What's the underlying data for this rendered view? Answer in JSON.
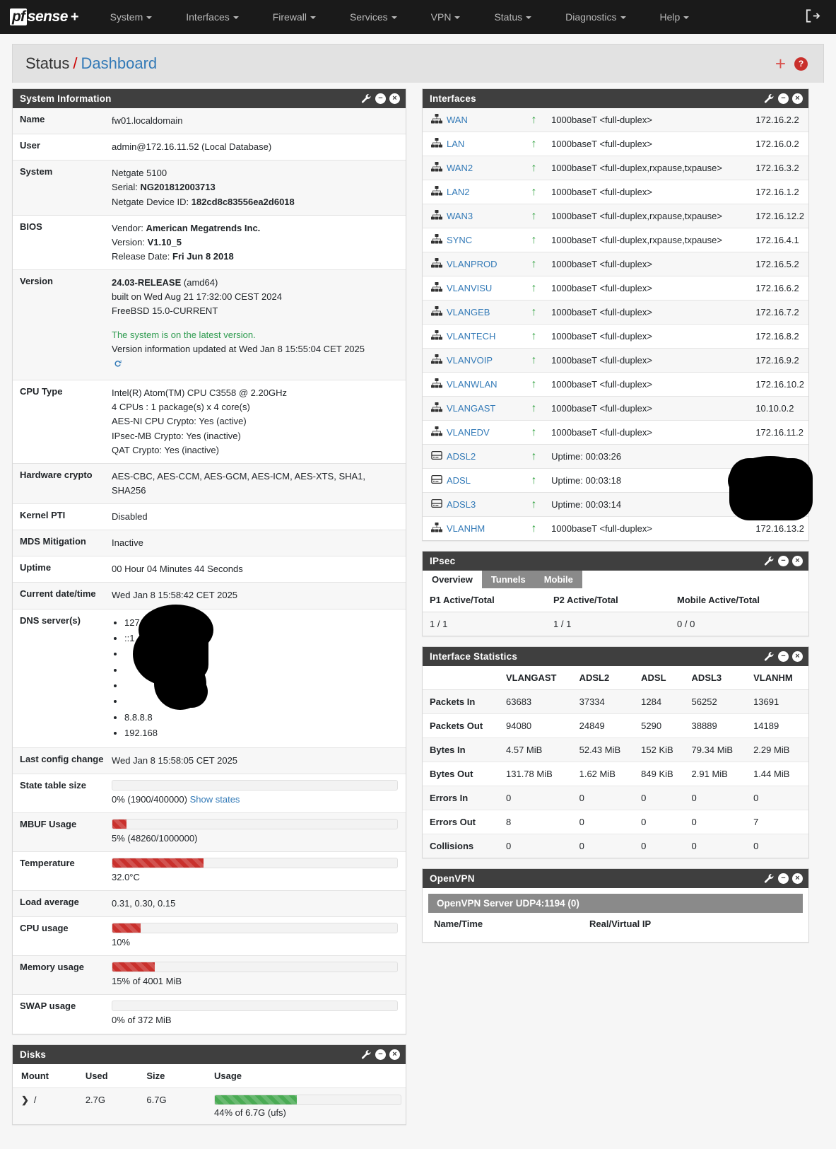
{
  "navbar": {
    "brand": {
      "pf": "pf",
      "sense": "sense",
      "plus": "+"
    },
    "items": [
      {
        "label": "System"
      },
      {
        "label": "Interfaces"
      },
      {
        "label": "Firewall"
      },
      {
        "label": "Services"
      },
      {
        "label": "VPN"
      },
      {
        "label": "Status"
      },
      {
        "label": "Diagnostics"
      },
      {
        "label": "Help"
      }
    ],
    "logout_icon": "logout-icon"
  },
  "breadcrumb": {
    "section": "Status",
    "separator": "/",
    "page": "Dashboard",
    "add_widget_icon": "+",
    "help_icon": "?"
  },
  "system_information": {
    "title": "System Information",
    "rows": [
      {
        "label": "Name",
        "value": "fw01.localdomain"
      },
      {
        "label": "User",
        "value": "admin@172.16.11.52 (Local Database)"
      },
      {
        "label": "System",
        "value": "Netgate 5100"
      },
      {
        "label": "BIOS",
        "value": ""
      },
      {
        "label": "Version",
        "value": ""
      }
    ],
    "system_model": "Netgate 5100",
    "system_serial_label": "Serial:",
    "system_serial": "NG201812003713",
    "system_devid_label": "Netgate Device ID:",
    "system_devid": "182cd8c83556ea2d6018",
    "bios_vendor_label": "Vendor:",
    "bios_vendor": "American Megatrends Inc.",
    "bios_version_label": "Version:",
    "bios_version": "V1.10_5",
    "bios_release_label": "Release Date:",
    "bios_release": "Fri Jun 8 2018",
    "version_release": "24.03-RELEASE",
    "version_arch": "(amd64)",
    "version_built": "built on Wed Aug 21 17:32:00 CEST 2024",
    "version_freebsd": "FreeBSD 15.0-CURRENT",
    "version_status": "The system is on the latest version.",
    "version_updated": "Version information updated at Wed Jan 8 15:55:04 CET 2025",
    "refresh_icon": "refresh-icon",
    "cpu_type_label": "CPU Type",
    "cpu_type_lines": [
      "Intel(R) Atom(TM) CPU C3558 @ 2.20GHz",
      "4 CPUs : 1 package(s) x 4 core(s)",
      "AES-NI CPU Crypto: Yes (active)",
      "IPsec-MB Crypto: Yes (inactive)",
      "QAT Crypto: Yes (inactive)"
    ],
    "hardware_crypto_label": "Hardware crypto",
    "hardware_crypto": "AES-CBC, AES-CCM, AES-GCM, AES-ICM, AES-XTS, SHA1, SHA256",
    "kernel_pti_label": "Kernel PTI",
    "kernel_pti": "Disabled",
    "mds_label": "MDS Mitigation",
    "mds": "Inactive",
    "uptime_label": "Uptime",
    "uptime": "00 Hour 04 Minutes 44 Seconds",
    "datetime_label": "Current date/time",
    "datetime": "Wed Jan 8 15:58:42 CET 2025",
    "dns_label": "DNS server(s)",
    "dns_servers": [
      "127.0.0.1",
      "::1",
      "",
      "",
      "",
      "",
      "8.8.8.8",
      "192.168"
    ],
    "last_config_label": "Last config change",
    "last_config": "Wed Jan 8 15:58:05 CET 2025",
    "state_table_label": "State table size",
    "state_table_pct": 0,
    "state_table_text": "0% (1900/400000)",
    "state_table_link": "Show states",
    "mbuf_label": "MBUF Usage",
    "mbuf_pct": 5,
    "mbuf_text": "5% (48260/1000000)",
    "temp_label": "Temperature",
    "temp_pct": 32,
    "temp_text": "32.0°C",
    "load_label": "Load average",
    "load": "0.31, 0.30, 0.15",
    "cpu_usage_label": "CPU usage",
    "cpu_usage_pct": 10,
    "cpu_usage_text": "10%",
    "memory_label": "Memory usage",
    "memory_pct": 15,
    "memory_text": "15% of 4001 MiB",
    "swap_label": "SWAP usage",
    "swap_pct": 0,
    "swap_text": "0% of 372 MiB"
  },
  "disks": {
    "title": "Disks",
    "headers": [
      "Mount",
      "Used",
      "Size",
      "Usage"
    ],
    "rows": [
      {
        "mount": "/",
        "used": "2.7G",
        "size": "6.7G",
        "usage_pct": 44,
        "usage_text": "44% of 6.7G (ufs)"
      }
    ]
  },
  "interfaces": {
    "title": "Interfaces",
    "rows": [
      {
        "name": "WAN",
        "icon": "sitemap-icon",
        "status": "up",
        "media": "1000baseT <full-duplex>",
        "ip": "172.16.2.2"
      },
      {
        "name": "LAN",
        "icon": "sitemap-icon",
        "status": "up",
        "media": "1000baseT <full-duplex>",
        "ip": "172.16.0.2"
      },
      {
        "name": "WAN2",
        "icon": "sitemap-icon",
        "status": "up",
        "media": "1000baseT <full-duplex,rxpause,txpause>",
        "ip": "172.16.3.2"
      },
      {
        "name": "LAN2",
        "icon": "sitemap-icon",
        "status": "up",
        "media": "1000baseT <full-duplex>",
        "ip": "172.16.1.2"
      },
      {
        "name": "WAN3",
        "icon": "sitemap-icon",
        "status": "up",
        "media": "1000baseT <full-duplex,rxpause,txpause>",
        "ip": "172.16.12.2"
      },
      {
        "name": "SYNC",
        "icon": "sitemap-icon",
        "status": "up",
        "media": "1000baseT <full-duplex,rxpause,txpause>",
        "ip": "172.16.4.1"
      },
      {
        "name": "VLANPROD",
        "icon": "sitemap-icon",
        "status": "up",
        "media": "1000baseT <full-duplex>",
        "ip": "172.16.5.2"
      },
      {
        "name": "VLANVISU",
        "icon": "sitemap-icon",
        "status": "up",
        "media": "1000baseT <full-duplex>",
        "ip": "172.16.6.2"
      },
      {
        "name": "VLANGEB",
        "icon": "sitemap-icon",
        "status": "up",
        "media": "1000baseT <full-duplex>",
        "ip": "172.16.7.2"
      },
      {
        "name": "VLANTECH",
        "icon": "sitemap-icon",
        "status": "up",
        "media": "1000baseT <full-duplex>",
        "ip": "172.16.8.2"
      },
      {
        "name": "VLANVOIP",
        "icon": "sitemap-icon",
        "status": "up",
        "media": "1000baseT <full-duplex>",
        "ip": "172.16.9.2"
      },
      {
        "name": "VLANWLAN",
        "icon": "sitemap-icon",
        "status": "up",
        "media": "1000baseT <full-duplex>",
        "ip": "172.16.10.2"
      },
      {
        "name": "VLANGAST",
        "icon": "sitemap-icon",
        "status": "up",
        "media": "1000baseT <full-duplex>",
        "ip": "10.10.0.2"
      },
      {
        "name": "VLANEDV",
        "icon": "sitemap-icon",
        "status": "up",
        "media": "1000baseT <full-duplex>",
        "ip": "172.16.11.2"
      },
      {
        "name": "ADSL2",
        "icon": "modem-icon",
        "status": "up",
        "media": "Uptime: 00:03:26",
        "ip": ""
      },
      {
        "name": "ADSL",
        "icon": "modem-icon",
        "status": "up",
        "media": "Uptime: 00:03:18",
        "ip": ""
      },
      {
        "name": "ADSL3",
        "icon": "modem-icon",
        "status": "up",
        "media": "Uptime: 00:03:14",
        "ip": ""
      },
      {
        "name": "VLANHM",
        "icon": "sitemap-icon",
        "status": "up",
        "media": "1000baseT <full-duplex>",
        "ip": "172.16.13.2"
      }
    ]
  },
  "ipsec": {
    "title": "IPsec",
    "tabs": [
      {
        "label": "Overview",
        "active": true
      },
      {
        "label": "Tunnels",
        "active": false
      },
      {
        "label": "Mobile",
        "active": false
      }
    ],
    "headers": [
      "P1 Active/Total",
      "P2 Active/Total",
      "Mobile Active/Total"
    ],
    "values": [
      "1 / 1",
      "1 / 1",
      "0 / 0"
    ]
  },
  "interface_statistics": {
    "title": "Interface Statistics",
    "columns": [
      "VLANGAST",
      "ADSL2",
      "ADSL",
      "ADSL3",
      "VLANHM"
    ],
    "rows": [
      {
        "label": "Packets In",
        "values": [
          "63683",
          "37334",
          "1284",
          "56252",
          "13691"
        ]
      },
      {
        "label": "Packets Out",
        "values": [
          "94080",
          "24849",
          "5290",
          "38889",
          "14189"
        ]
      },
      {
        "label": "Bytes In",
        "values": [
          "4.57 MiB",
          "52.43 MiB",
          "152 KiB",
          "79.34 MiB",
          "2.29 MiB"
        ]
      },
      {
        "label": "Bytes Out",
        "values": [
          "131.78 MiB",
          "1.62 MiB",
          "849 KiB",
          "2.91 MiB",
          "1.44 MiB"
        ]
      },
      {
        "label": "Errors In",
        "values": [
          "0",
          "0",
          "0",
          "0",
          "0"
        ]
      },
      {
        "label": "Errors Out",
        "values": [
          "8",
          "0",
          "0",
          "0",
          "7"
        ]
      },
      {
        "label": "Collisions",
        "values": [
          "0",
          "0",
          "0",
          "0",
          "0"
        ]
      }
    ]
  },
  "openvpn": {
    "title": "OpenVPN",
    "server_title": "OpenVPN Server UDP4:1194 (0)",
    "col_name_time": "Name/Time",
    "col_real_virtual": "Real/Virtual IP"
  },
  "colors": {
    "navbar_bg": "#1a1a1a",
    "panel_head_bg": "#3f3f3f",
    "link": "#337ab7",
    "danger": "#c9302c",
    "success": "#4aab54",
    "status_up": "#2fa13f",
    "latest_version": "#2e9b4f"
  }
}
